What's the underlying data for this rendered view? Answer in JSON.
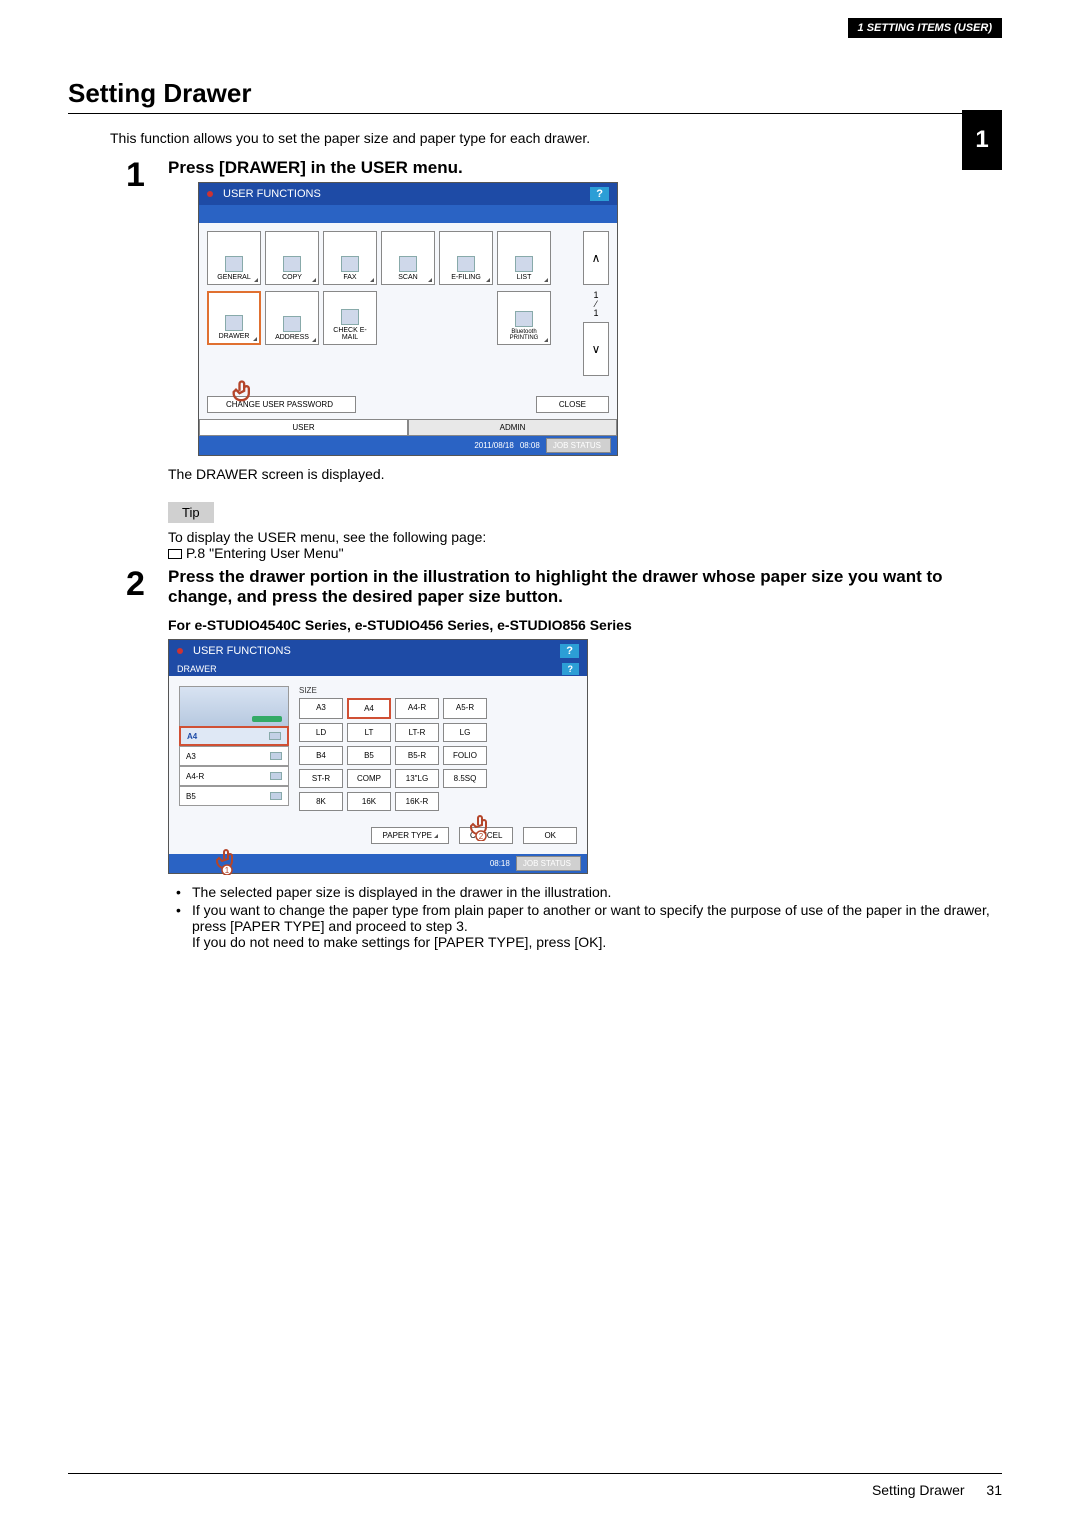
{
  "header": {
    "chapter": "1 SETTING ITEMS (USER)"
  },
  "sideTab": "1",
  "section": {
    "title": "Setting Drawer"
  },
  "intro": "This function allows you to set the paper size and paper type for each drawer.",
  "step1": {
    "num": "1",
    "title": "Press [DRAWER] in the USER menu.",
    "after": "The DRAWER screen is displayed.",
    "tipLabel": "Tip",
    "tipLine": "To display the USER menu, see the following page:",
    "ref": "P.8 \"Entering User Menu\""
  },
  "step2": {
    "num": "2",
    "title": "Press the drawer portion in the illustration to highlight the drawer whose paper size you want to change, and press the desired paper size button.",
    "forLine": "For e-STUDIO4540C Series, e-STUDIO456 Series, e-STUDIO856 Series",
    "bullets": [
      "The selected paper size is displayed in the drawer in the illustration.",
      "If you want to change the paper type from plain paper to another or want to specify the purpose of use of the paper in the drawer, press [PAPER TYPE] and proceed to step 3.\nIf you do not need to make settings for [PAPER TYPE], press [OK]."
    ]
  },
  "panel1": {
    "title": "USER FUNCTIONS",
    "help": "?",
    "tilesRow1": [
      "GENERAL",
      "COPY",
      "FAX",
      "SCAN",
      "E-FILING",
      "LIST"
    ],
    "tilesRow2": [
      "DRAWER",
      "ADDRESS",
      "CHECK E-MAIL"
    ],
    "bt": "Bluetooth PRINTING",
    "frac1": "1",
    "frac2": "1",
    "changePw": "CHANGE USER PASSWORD",
    "close": "CLOSE",
    "tabUser": "USER",
    "tabAdmin": "ADMIN",
    "date": "2011/08/18",
    "time": "08:08",
    "job": "JOB STATUS"
  },
  "panel2": {
    "title": "USER FUNCTIONS",
    "crumb": "DRAWER",
    "help": "?",
    "drawers": [
      "A4",
      "A3",
      "A4-R",
      "B5"
    ],
    "sizeLabel": "SIZE",
    "sizes": [
      "A3",
      "A4",
      "A4-R",
      "A5-R",
      "LD",
      "LT",
      "LT-R",
      "LG",
      "B4",
      "B5",
      "B5-R",
      "FOLIO",
      "ST-R",
      "COMP",
      "13\"LG",
      "8.5SQ",
      "8K",
      "16K",
      "16K-R"
    ],
    "paperType": "PAPER TYPE",
    "cancel": "CANCEL",
    "ok": "OK",
    "time": "08:18",
    "job": "JOB STATUS",
    "hand1": "1",
    "hand2": "2"
  },
  "footer": {
    "title": "Setting Drawer",
    "page": "31"
  }
}
